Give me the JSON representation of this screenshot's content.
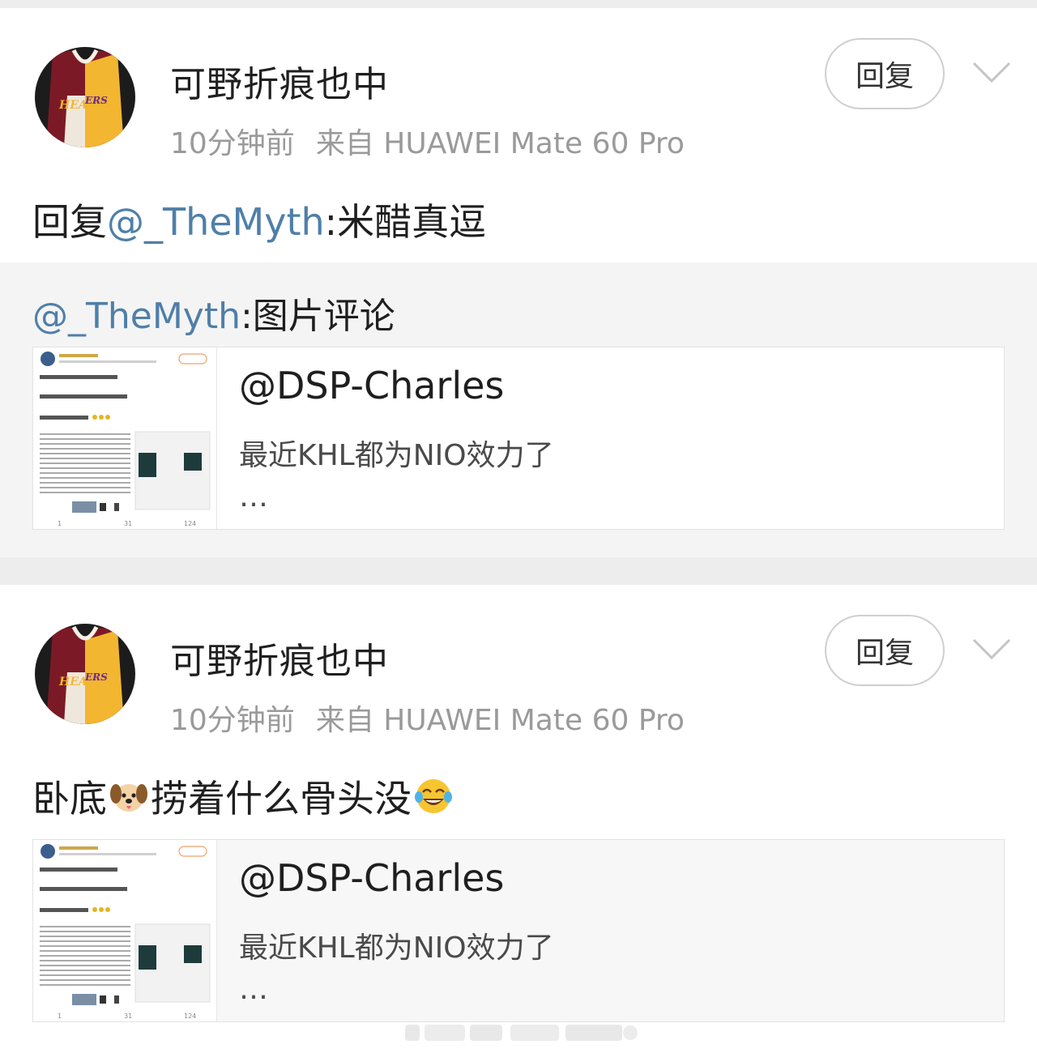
{
  "comments": [
    {
      "username": "可野折痕也中",
      "time": "10分钟前",
      "source": "来自 HUAWEI Mate 60 Pro",
      "reply_label": "回复",
      "text_prefix": "回复",
      "text_mention": "@_TheMyth",
      "text_suffix": ":米醋真逗",
      "quote": {
        "mention": "@_TheMyth",
        "text": ":图片评论",
        "card": {
          "title": "@DSP-Charles",
          "desc": "最近KHL都为NIO效力了",
          "more": "…"
        }
      }
    },
    {
      "username": "可野折痕也中",
      "time": "10分钟前",
      "source": "来自 HUAWEI Mate 60 Pro",
      "reply_label": "回复",
      "text_part1": "卧底",
      "emoji1": "dog-face-emoji",
      "text_part2": "捞着什么骨头没",
      "emoji2": "tears-of-joy-emoji",
      "card": {
        "title": "@DSP-Charles",
        "desc": "最近KHL都为NIO效力了",
        "more": "…"
      }
    }
  ],
  "icons": {
    "more": "chevron-down-icon",
    "avatar": "jersey-avatar"
  },
  "colors": {
    "mention": "#4f7fa8",
    "meta": "#9a9a9a",
    "divider": "#ededed",
    "quote_bg": "#f4f4f4"
  }
}
